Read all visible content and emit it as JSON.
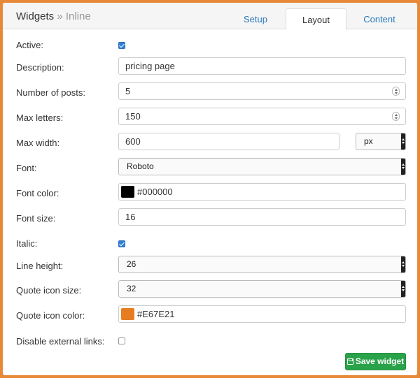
{
  "header": {
    "title": "Widgets",
    "separator": "»",
    "subtitle": "Inline",
    "tabs": [
      {
        "label": "Setup"
      },
      {
        "label": "Layout"
      },
      {
        "label": "Content"
      }
    ],
    "active_tab": "Layout"
  },
  "form": {
    "active": {
      "label": "Active:",
      "checked": true
    },
    "description": {
      "label": "Description:",
      "value": "pricing page"
    },
    "number_of_posts": {
      "label": "Number of posts:",
      "value": "5"
    },
    "max_letters": {
      "label": "Max letters:",
      "value": "150"
    },
    "max_width": {
      "label": "Max width:",
      "value": "600",
      "unit": "px"
    },
    "font": {
      "label": "Font:",
      "value": "Roboto"
    },
    "font_color": {
      "label": "Font color:",
      "value": "#000000",
      "swatch": "#000000"
    },
    "font_size": {
      "label": "Font size:",
      "value": "16"
    },
    "italic": {
      "label": "Italic:",
      "checked": true
    },
    "line_height": {
      "label": "Line height:",
      "value": "26"
    },
    "quote_icon_size": {
      "label": "Quote icon size:",
      "value": "32"
    },
    "quote_icon_color": {
      "label": "Quote icon color:",
      "value": "#E67E21",
      "swatch": "#E67E21"
    },
    "disable_external_links": {
      "label": "Disable external links:",
      "checked": false
    }
  },
  "actions": {
    "save_label": "Save widget",
    "save_icon": "floppy-disk-icon"
  },
  "colors": {
    "frame": "#e8893a",
    "accent_blue": "#2f7fd8",
    "save_green": "#2aa24a"
  }
}
